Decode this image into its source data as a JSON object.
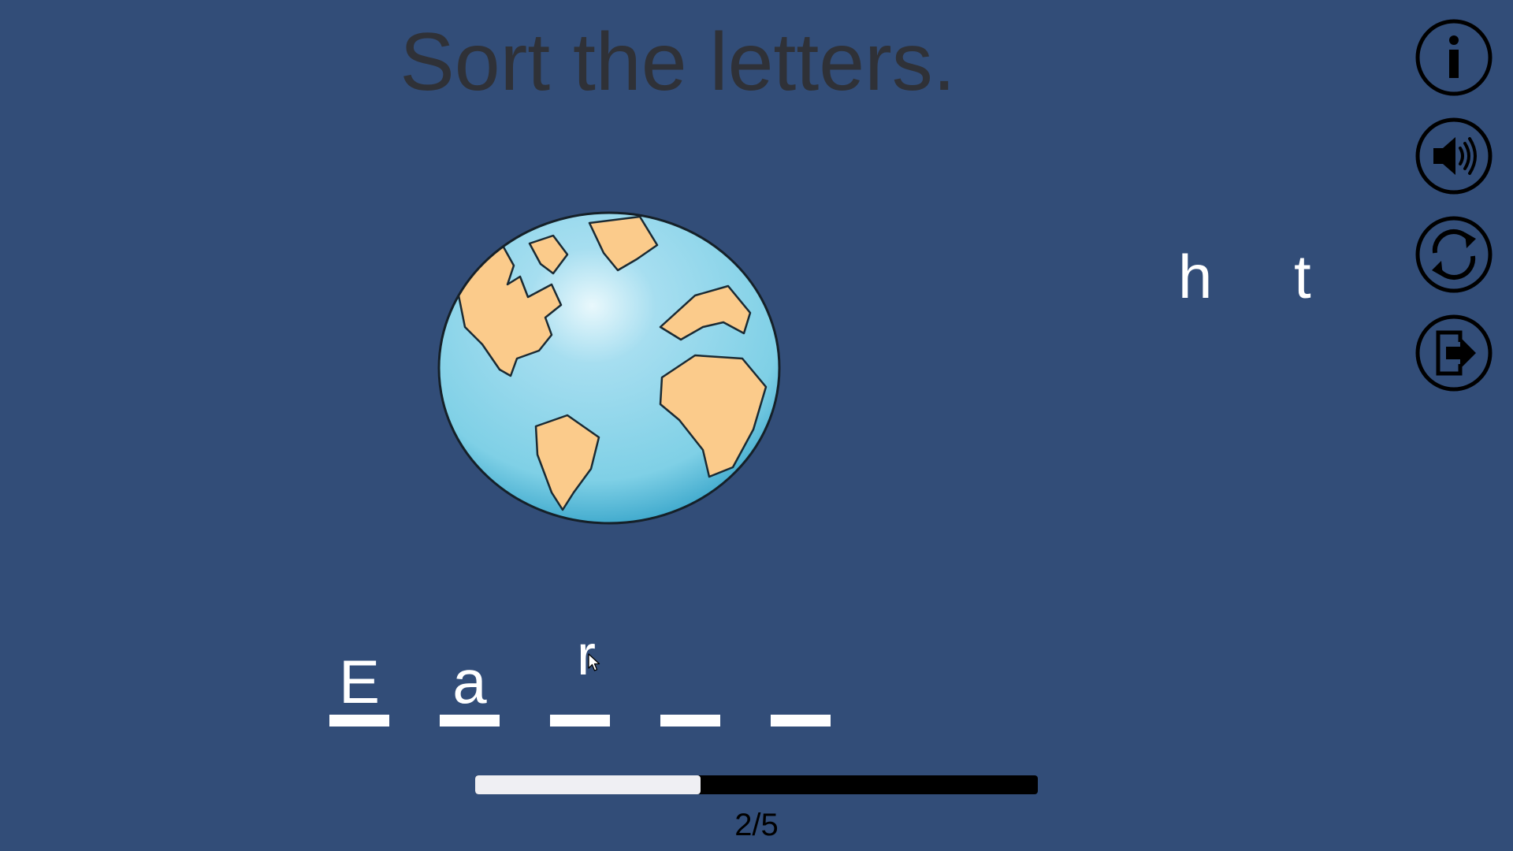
{
  "title": "Sort the letters.",
  "side_buttons": [
    {
      "name": "info",
      "icon": "info-icon"
    },
    {
      "name": "sound",
      "icon": "speaker-icon"
    },
    {
      "name": "restart",
      "icon": "restart-icon"
    },
    {
      "name": "exit",
      "icon": "exit-icon"
    }
  ],
  "picture": {
    "icon": "globe-image"
  },
  "letter_pool": [
    "h",
    "t"
  ],
  "answer_slots": [
    "E",
    "a",
    "",
    "",
    ""
  ],
  "dragging_letter": "r",
  "progress": {
    "current": 2,
    "total": 5,
    "label": "2/5"
  },
  "colors": {
    "background": "#324d78",
    "title_text": "#2f3137",
    "letters": "#ffffff",
    "progress_fill": "#efeff3",
    "progress_track": "#000000",
    "globe_ocean": "#86d3e8",
    "globe_land": "#fbcb8b"
  }
}
